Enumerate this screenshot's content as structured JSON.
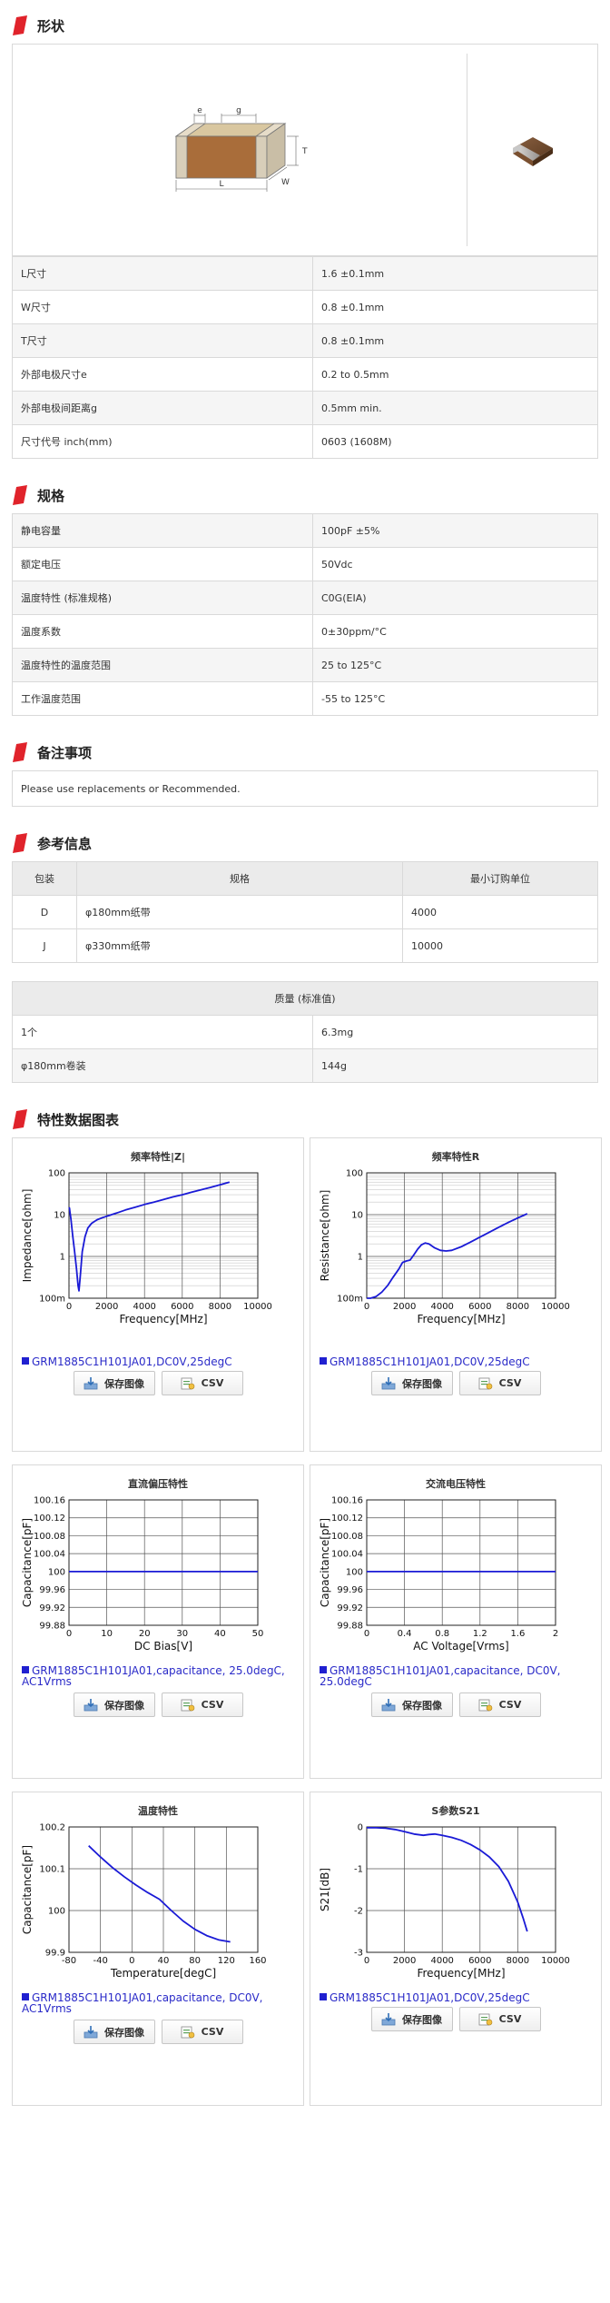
{
  "sections": {
    "shape": "形状",
    "specs": "规格",
    "notes": "备注事项",
    "reference": "参考信息",
    "charts": "特性数据图表"
  },
  "colors": {
    "accent": "#e0232b",
    "series": "#1a1ad6",
    "row_alt": "#f5f5f5",
    "border": "#d9d9d9"
  },
  "dimension_figure": {
    "e": "e",
    "g": "g",
    "T": "T",
    "L": "L",
    "W": "W"
  },
  "dimensions": [
    {
      "label": "L尺寸",
      "value": "1.6 ±0.1mm"
    },
    {
      "label": "W尺寸",
      "value": "0.8 ±0.1mm"
    },
    {
      "label": "T尺寸",
      "value": "0.8 ±0.1mm"
    },
    {
      "label": "外部电极尺寸e",
      "value": "0.2 to 0.5mm"
    },
    {
      "label": "外部电极间距离g",
      "value": "0.5mm min."
    },
    {
      "label": "尺寸代号 inch(mm)",
      "value": "0603 (1608M)"
    }
  ],
  "specs": [
    {
      "label": "静电容量",
      "value": "100pF ±5%"
    },
    {
      "label": "额定电压",
      "value": "50Vdc"
    },
    {
      "label": "温度特性 (标准规格)",
      "value": "C0G(EIA)"
    },
    {
      "label": "温度系数",
      "value": "0±30ppm/°C"
    },
    {
      "label": "温度特性的温度范围",
      "value": "25 to 125°C"
    },
    {
      "label": "工作温度范围",
      "value": "-55 to 125°C"
    }
  ],
  "notes": "Please use replacements or Recommended.",
  "packaging": {
    "headers": [
      "包装",
      "规格",
      "最小订购单位"
    ],
    "rows": [
      [
        "D",
        "φ180mm纸带",
        "4000"
      ],
      [
        "J",
        "φ330mm纸带",
        "10000"
      ]
    ]
  },
  "mass": {
    "header": "质量 (标准值)",
    "rows": [
      [
        "1个",
        "6.3mg"
      ],
      [
        "φ180mm卷装",
        "144g"
      ]
    ]
  },
  "buttons": {
    "save": "保存图像",
    "csv": "CSV"
  },
  "chart_data": [
    {
      "type": "line",
      "title": "频率特性|Z|",
      "xlabel": "Frequency[MHz]",
      "ylabel": "Impedance[ohm]",
      "log_y": true,
      "xlim": [
        0,
        10000
      ],
      "ylim": [
        0.1,
        100
      ],
      "x_ticks": [
        "0",
        "2000",
        "4000",
        "6000",
        "8000",
        "10000"
      ],
      "y_ticks": [
        "100m",
        "1",
        "10",
        "100"
      ],
      "x": [
        10,
        30,
        60,
        100,
        150,
        200,
        300,
        400,
        480,
        530,
        600,
        700,
        850,
        1000,
        1200,
        1500,
        1800,
        2200,
        2600,
        3000,
        3500,
        4000,
        4500,
        5000,
        5500,
        6000,
        6500,
        7000,
        7500,
        8000,
        8500
      ],
      "series": [
        {
          "name": "GRM1885C1H101JA01,DC0V,25degC",
          "values": [
            15,
            14,
            11,
            8,
            5,
            3,
            1.3,
            0.5,
            0.2,
            0.15,
            0.35,
            1.3,
            3.0,
            4.8,
            6.2,
            7.6,
            8.5,
            9.8,
            11.2,
            13,
            15,
            17.5,
            20,
            23,
            26.5,
            30,
            34.5,
            39.5,
            45,
            52,
            60
          ]
        }
      ],
      "legend": "GRM1885C1H101JA01,DC0V,25degC"
    },
    {
      "type": "line",
      "title": "频率特性R",
      "xlabel": "Frequency[MHz]",
      "ylabel": "Resistance[ohm]",
      "log_y": true,
      "xlim": [
        0,
        10000
      ],
      "ylim": [
        0.1,
        100
      ],
      "x_ticks": [
        "0",
        "2000",
        "4000",
        "6000",
        "8000",
        "10000"
      ],
      "y_ticks": [
        "100m",
        "1",
        "10",
        "100"
      ],
      "x": [
        10,
        200,
        500,
        800,
        1100,
        1400,
        1700,
        1900,
        2100,
        2300,
        2500,
        2700,
        2900,
        3100,
        3300,
        3600,
        3900,
        4200,
        4500,
        5000,
        5500,
        6000,
        6500,
        7000,
        7500,
        8000,
        8500
      ],
      "series": [
        {
          "name": "GRM1885C1H101JA01,DC0V,25degC",
          "values": [
            0.1,
            0.1,
            0.11,
            0.14,
            0.2,
            0.32,
            0.5,
            0.72,
            0.78,
            0.82,
            1.1,
            1.5,
            1.9,
            2.1,
            2.0,
            1.6,
            1.4,
            1.35,
            1.4,
            1.7,
            2.2,
            2.9,
            3.8,
            5.0,
            6.5,
            8.3,
            10.5
          ]
        }
      ],
      "legend": "GRM1885C1H101JA01,DC0V,25degC"
    },
    {
      "type": "line",
      "title": "直流偏压特性",
      "xlabel": "DC Bias[V]",
      "ylabel": "Capacitance[pF]",
      "xlim": [
        0,
        50
      ],
      "ylim": [
        99.88,
        100.16
      ],
      "x_ticks": [
        "0",
        "10",
        "20",
        "30",
        "40",
        "50"
      ],
      "y_ticks": [
        "99.88",
        "99.92",
        "99.96",
        "100",
        "100.04",
        "100.08",
        "100.12",
        "100.16"
      ],
      "x": [
        0,
        10,
        20,
        30,
        40,
        50
      ],
      "series": [
        {
          "name": "GRM1885C1H101JA01,capacitance, 25.0degC, AC1Vrms",
          "values": [
            100,
            100,
            100,
            100,
            100,
            100
          ]
        }
      ],
      "legend": "GRM1885C1H101JA01,capacitance, 25.0degC, AC1Vrms"
    },
    {
      "type": "line",
      "title": "交流电压特性",
      "xlabel": "AC Voltage[Vrms]",
      "ylabel": "Capacitance[pF]",
      "xlim": [
        0,
        2
      ],
      "ylim": [
        99.88,
        100.16
      ],
      "x_ticks": [
        "0",
        "0.4",
        "0.8",
        "1.2",
        "1.6",
        "2"
      ],
      "y_ticks": [
        "99.88",
        "99.92",
        "99.96",
        "100",
        "100.04",
        "100.08",
        "100.12",
        "100.16"
      ],
      "x": [
        0,
        0.4,
        0.8,
        1.2,
        1.6,
        2
      ],
      "series": [
        {
          "name": "GRM1885C1H101JA01,capacitance, DC0V, 25.0degC",
          "values": [
            100,
            100,
            100,
            100,
            100,
            100
          ]
        }
      ],
      "legend": "GRM1885C1H101JA01,capacitance, DC0V, 25.0degC"
    },
    {
      "type": "line",
      "title": "温度特性",
      "xlabel": "Temperature[degC]",
      "ylabel": "Capacitance[pF]",
      "xlim": [
        -80,
        160
      ],
      "ylim": [
        99.9,
        100.2
      ],
      "x_ticks": [
        "-80",
        "-40",
        "0",
        "40",
        "80",
        "120",
        "160"
      ],
      "y_ticks": [
        "99.9",
        "100",
        "100.1",
        "100.2"
      ],
      "x": [
        -55,
        -40,
        -25,
        -10,
        5,
        20,
        35,
        50,
        65,
        80,
        95,
        110,
        125
      ],
      "series": [
        {
          "name": "GRM1885C1H101JA01,capacitance, DC0V, AC1Vrms",
          "values": [
            100.155,
            100.128,
            100.103,
            100.081,
            100.061,
            100.043,
            100.027,
            100.0,
            99.975,
            99.955,
            99.94,
            99.93,
            99.925
          ]
        }
      ],
      "legend": "GRM1885C1H101JA01,capacitance, DC0V, AC1Vrms"
    },
    {
      "type": "line",
      "title": "S参数S21",
      "xlabel": "Frequency[MHz]",
      "ylabel": "S21[dB]",
      "xlim": [
        0,
        10000
      ],
      "ylim": [
        -3,
        0
      ],
      "x_ticks": [
        "0",
        "2000",
        "4000",
        "6000",
        "8000",
        "10000"
      ],
      "y_ticks": [
        "-3",
        "-2",
        "-1",
        "0"
      ],
      "x": [
        0,
        500,
        1000,
        1500,
        2000,
        2500,
        3000,
        3300,
        3600,
        4000,
        4500,
        5000,
        5500,
        6000,
        6500,
        7000,
        7500,
        8000,
        8300,
        8500
      ],
      "series": [
        {
          "name": "GRM1885C1H101JA01,DC0V,25degC",
          "values": [
            -0.02,
            -0.02,
            -0.03,
            -0.06,
            -0.11,
            -0.17,
            -0.2,
            -0.18,
            -0.17,
            -0.2,
            -0.25,
            -0.32,
            -0.42,
            -0.55,
            -0.72,
            -0.95,
            -1.3,
            -1.8,
            -2.2,
            -2.5
          ]
        }
      ],
      "legend": "GRM1885C1H101JA01,DC0V,25degC"
    }
  ]
}
